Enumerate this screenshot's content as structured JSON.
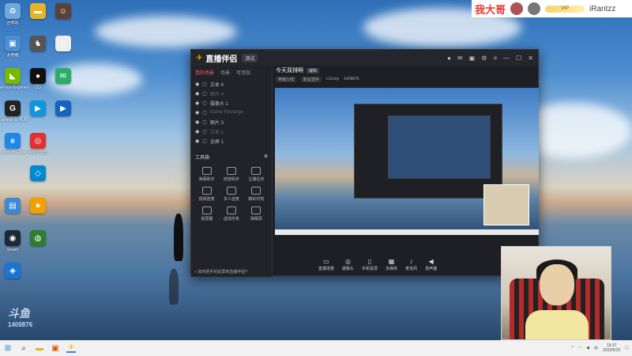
{
  "desktop_icons": [
    {
      "label": "回收站",
      "icon": "recycle-bin-icon",
      "color": "#6ea8dc",
      "glyph": "♻"
    },
    {
      "label": "此电脑",
      "icon": "computer-icon",
      "color": "#4a8fd6",
      "glyph": "▣"
    },
    {
      "label": "GeForce Experience",
      "icon": "nvidia-icon",
      "color": "#76b900",
      "glyph": "◣"
    },
    {
      "label": "Logitech G HUB",
      "icon": "logitech-icon",
      "color": "#222222",
      "glyph": "G"
    },
    {
      "label": "Microsoft Edge",
      "icon": "edge-icon",
      "color": "#1e88e5",
      "glyph": "e"
    },
    {
      "label": "",
      "icon": "folder-icon",
      "color": "#3b8ad8",
      "glyph": "▤"
    },
    {
      "label": "Steam",
      "icon": "steam-icon",
      "color": "#1b2838",
      "glyph": "◉"
    },
    {
      "label": "",
      "icon": "app-blue-icon",
      "color": "#1976d2",
      "glyph": "◈"
    },
    {
      "label": "",
      "icon": "folder-yellow-icon",
      "color": "#e6b422",
      "glyph": "▬"
    },
    {
      "label": "",
      "icon": "game-icon",
      "color": "#555555",
      "glyph": "♞"
    },
    {
      "label": "QQ",
      "icon": "qq-icon",
      "color": "#111111",
      "glyph": "●"
    },
    {
      "label": "",
      "icon": "bilibili-icon",
      "color": "#1296db",
      "glyph": "▶"
    },
    {
      "label": "网易云音乐",
      "icon": "netease-music-icon",
      "color": "#e03030",
      "glyph": "◎"
    },
    {
      "label": "",
      "icon": "app-cyan-icon",
      "color": "#0288d1",
      "glyph": "◇"
    },
    {
      "label": "",
      "icon": "gameplus-icon",
      "color": "#f0a000",
      "glyph": "★"
    },
    {
      "label": "",
      "icon": "earth-icon",
      "color": "#2e7d32",
      "glyph": "◍"
    },
    {
      "label": "",
      "icon": "character-icon",
      "color": "#5d4037",
      "glyph": "☺"
    },
    {
      "label": "",
      "icon": "doc-icon",
      "color": "#eeeeee",
      "glyph": "▯"
    },
    {
      "label": "",
      "icon": "weixin-icon",
      "color": "#2aae67",
      "glyph": "✉"
    },
    {
      "label": "",
      "icon": "media-icon",
      "color": "#1565c0",
      "glyph": "▶"
    }
  ],
  "stream_overlay": {
    "red_text": "我大哥",
    "username": "iRantzz",
    "badge": "VIP"
  },
  "app": {
    "title": "直播伴侣",
    "version_tag": "测试",
    "scene_tabs": [
      "我的场景",
      "场景",
      "可添加"
    ],
    "sources": [
      {
        "label": "文本 4",
        "faded": false
      },
      {
        "label": "图片 4",
        "faded": true
      },
      {
        "label": "摄像头 1",
        "faded": false
      },
      {
        "label": "Game Revenge",
        "faded": true
      },
      {
        "label": "图片 3",
        "faded": false
      },
      {
        "label": "文本 1",
        "faded": true
      },
      {
        "label": "全屏 1",
        "faded": false
      }
    ],
    "tools_heading": "工具箱",
    "tools": [
      {
        "label": "弹幕助手",
        "icon": "danmaku-icon"
      },
      {
        "label": "房管助手",
        "icon": "admin-icon"
      },
      {
        "label": "主播任务",
        "icon": "task-icon"
      },
      {
        "label": "视频连麦",
        "icon": "video-link-icon"
      },
      {
        "label": "多人连麦",
        "icon": "multi-link-icon"
      },
      {
        "label": "精彩时刻",
        "icon": "highlight-icon"
      },
      {
        "label": "连屏器",
        "icon": "screen-icon"
      },
      {
        "label": "虚拟形象",
        "icon": "avatar-icon"
      },
      {
        "label": "弹幕屏",
        "icon": "danmaku-screen-icon"
      }
    ],
    "tip": "如何把手机投屏到直播伴侣?",
    "scene_name": "今天双排啊",
    "scene_tag": "编辑",
    "scene_sub": [
      "穿越火线",
      "职业选手",
      "LOLmy",
      "1409876"
    ],
    "bottom_tools": [
      {
        "label": "直播场景",
        "icon": "monitor-icon",
        "glyph": "▭"
      },
      {
        "label": "摄像头",
        "icon": "camera-icon",
        "glyph": "◎"
      },
      {
        "label": "手机投屏",
        "icon": "phone-cast-icon",
        "glyph": "▯"
      },
      {
        "label": "多媒体",
        "icon": "multimedia-icon",
        "glyph": "▦"
      },
      {
        "label": "麦克风",
        "icon": "mic-icon",
        "glyph": "♪"
      },
      {
        "label": "扬声器",
        "icon": "speaker-icon",
        "glyph": "◀"
      }
    ]
  },
  "watermark": {
    "big": "斗鱼",
    "sub": "1409876"
  },
  "taskbar": {
    "time": "19:37",
    "date": "2022/5/22",
    "lang": "中"
  }
}
